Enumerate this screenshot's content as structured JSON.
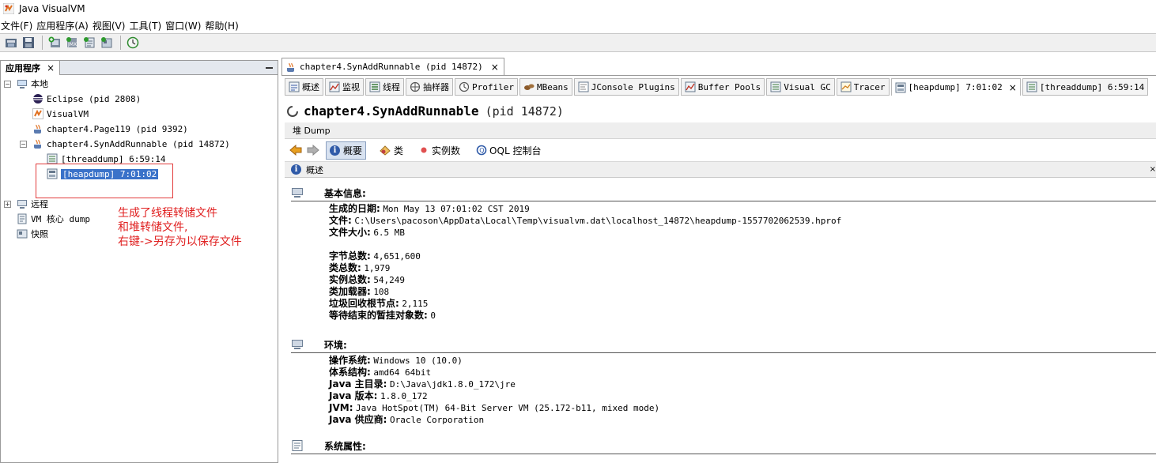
{
  "window": {
    "title": "Java VisualVM"
  },
  "menu": [
    "文件(F)",
    "应用程序(A)",
    "视图(V)",
    "工具(T)",
    "窗口(W)",
    "帮助(H)"
  ],
  "left_panel": {
    "tab_label": "应用程序",
    "tab_close": "×",
    "tree": {
      "local": "本地",
      "eclipse": "Eclipse (pid 2808)",
      "visualvm": "VisualVM",
      "page119": "chapter4.Page119 (pid 9392)",
      "synadd": "chapter4.SynAddRunnable (pid 14872)",
      "threaddump": "[threaddump] 6:59:14",
      "heapdump": "[heapdump] 7:01:02",
      "remote": "远程",
      "vmcore": "VM 核心 dump",
      "snapshot": "快照"
    },
    "annotation": [
      "生成了线程转储文件",
      "和堆转储文件,",
      "右键->另存为以保存文件"
    ]
  },
  "doc_tab": {
    "label": "chapter4.SynAddRunnable (pid 14872)",
    "close": "×"
  },
  "sub_tabs": [
    "概述",
    "监视",
    "线程",
    "抽样器",
    "Profiler",
    "MBeans",
    "JConsole Plugins",
    "Buffer Pools",
    "Visual GC",
    "Tracer",
    "[heapdump] 7:01:02",
    "[threaddump] 6:59:14"
  ],
  "sub_tab_close": "×",
  "process": {
    "name": "chapter4.SynAddRunnable",
    "pid": "(pid 14872)"
  },
  "heap_bar": "堆 Dump",
  "nav": {
    "summary": "概要",
    "classes": "类",
    "instances": "实例数",
    "oql": "OQL 控制台"
  },
  "overview_bar": {
    "label": "概述",
    "close": "×"
  },
  "basic": {
    "title": "基本信息:",
    "rows": [
      {
        "k": "生成的日期:",
        "v": "Mon May 13 07:01:02 CST 2019"
      },
      {
        "k": "文件:",
        "v": "C:\\Users\\pacoson\\AppData\\Local\\Temp\\visualvm.dat\\localhost_14872\\heapdump-1557702062539.hprof"
      },
      {
        "k": "文件大小:",
        "v": "6.5 MB"
      }
    ],
    "rows2": [
      {
        "k": "字节总数:",
        "v": "4,651,600"
      },
      {
        "k": "类总数:",
        "v": "1,979"
      },
      {
        "k": "实例总数:",
        "v": "54,249"
      },
      {
        "k": "类加载器:",
        "v": "108"
      },
      {
        "k": "垃圾回收根节点:",
        "v": "2,115"
      },
      {
        "k": "等待结束的暂挂对象数:",
        "v": "0"
      }
    ]
  },
  "env": {
    "title": "环境:",
    "rows": [
      {
        "k": "操作系统:",
        "v": "Windows 10 (10.0)"
      },
      {
        "k": "体系结构:",
        "v": "amd64 64bit"
      },
      {
        "k": "Java 主目录:",
        "v": "D:\\Java\\jdk1.8.0_172\\jre"
      },
      {
        "k": "Java 版本:",
        "v": "1.8.0_172"
      },
      {
        "k": "JVM:",
        "v": "Java HotSpot(TM) 64-Bit Server VM (25.172-b11, mixed mode)"
      },
      {
        "k": "Java 供应商:",
        "v": "Oracle Corporation"
      }
    ]
  },
  "sysprops": {
    "title": "系统属性:"
  },
  "colors": {
    "selection": "#3a72c9",
    "annotation": "#e02020",
    "accent": "#2f5aa8"
  }
}
